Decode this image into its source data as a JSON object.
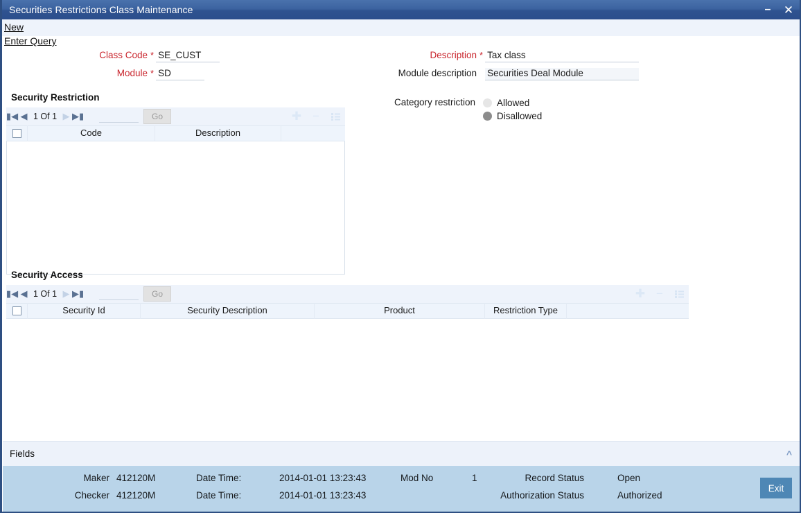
{
  "window": {
    "title": "Securities Restrictions Class Maintenance",
    "minimize_label": "–",
    "close_label": "✕"
  },
  "actions": {
    "new_label": "New",
    "enter_query_label": "Enter Query"
  },
  "form": {
    "class_code": {
      "label": "Class Code",
      "required_mark": "*",
      "value": "SE_CUST"
    },
    "module": {
      "label": "Module",
      "required_mark": "*",
      "value": "SD"
    },
    "description": {
      "label": "Description",
      "required_mark": "*",
      "value": "Tax class"
    },
    "module_description": {
      "label": "Module description",
      "value": "Securities Deal Module"
    },
    "category_restriction": {
      "label": "Category restriction",
      "options": [
        {
          "label": "Allowed",
          "selected": false
        },
        {
          "label": "Disallowed",
          "selected": true
        }
      ]
    }
  },
  "security_restriction": {
    "section_title": "Security Restriction",
    "toolbar": {
      "first_icon": "first-page-icon",
      "prev_icon": "prev-page-icon",
      "page_text": "1 Of 1",
      "next_icon": "next-page-icon",
      "last_icon": "last-page-icon",
      "goto_value": "",
      "go_label": "Go",
      "add_icon": "plus-icon",
      "remove_icon": "minus-icon",
      "options_icon": "list-options-icon"
    },
    "columns": [
      "Code",
      "Description"
    ],
    "rows": []
  },
  "security_access": {
    "section_title": "Security Access",
    "toolbar": {
      "first_icon": "first-page-icon",
      "prev_icon": "prev-page-icon",
      "page_text": "1 Of 1",
      "next_icon": "next-page-icon",
      "last_icon": "last-page-icon",
      "goto_value": "",
      "go_label": "Go",
      "add_icon": "plus-icon",
      "remove_icon": "minus-icon",
      "options_icon": "list-options-icon"
    },
    "columns": [
      "Security Id",
      "Security Description",
      "Product",
      "Restriction Type"
    ],
    "rows": []
  },
  "fields_bar": {
    "label": "Fields",
    "collapse_icon": "chevron-up-icon"
  },
  "audit": {
    "maker_label": "Maker",
    "maker_value": "412120M",
    "checker_label": "Checker",
    "checker_value": "412120M",
    "date_time_label_1": "Date Time:",
    "date_time_value_1": "2014-01-01 13:23:43",
    "date_time_label_2": "Date Time:",
    "date_time_value_2": "2014-01-01 13:23:43",
    "mod_no_label": "Mod No",
    "mod_no_value": "1",
    "record_status_label": "Record Status",
    "record_status_value": "Open",
    "authorization_status_label": "Authorization Status",
    "authorization_status_value": "Authorized",
    "exit_label": "Exit"
  },
  "colors": {
    "titlebar": "#3c63a0",
    "required_label": "#c9252d",
    "footer": "#b9d4e9",
    "exit_button": "#4e87b5",
    "grid_header": "#eef4fc"
  }
}
